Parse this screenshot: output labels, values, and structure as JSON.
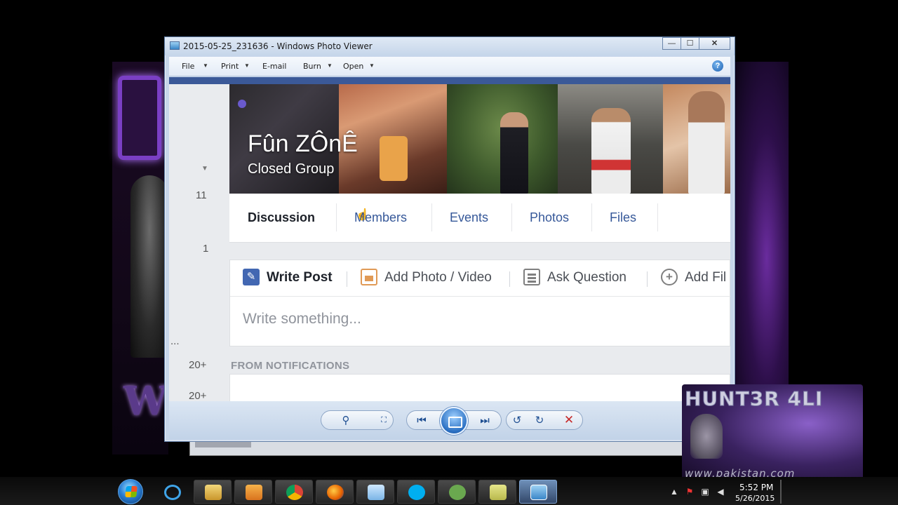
{
  "window": {
    "title": "2015-05-25_231636 - Windows Photo Viewer",
    "controls": {
      "minimize": "—",
      "maximize": "☐",
      "close": "✕"
    }
  },
  "menu": {
    "file": "File",
    "print": "Print",
    "email": "E-mail",
    "burn": "Burn",
    "open": "Open",
    "help_icon": "?"
  },
  "facebook": {
    "left_counts": [
      "11",
      "1",
      "...",
      "20+",
      "20+"
    ],
    "group_name": "Fûn ZÔnÊ",
    "group_type": "Closed Group",
    "tabs": [
      "Discussion",
      "Members",
      "Events",
      "Photos",
      "Files"
    ],
    "active_tab": "Discussion",
    "composer": {
      "write_post": "Write Post",
      "add_photo": "Add Photo / Video",
      "ask_question": "Ask Question",
      "add_file": "Add Fil",
      "placeholder": "Write something..."
    },
    "notifications_heading": "FROM NOTIFICATIONS"
  },
  "viewer_controls": {
    "zoom": "⚲",
    "actual_size": "⛶",
    "previous": "⏮",
    "next": "⏭",
    "rotate_ccw": "↺",
    "rotate_cw": "↻",
    "delete": "✕"
  },
  "wallpaper": {
    "watermark_title": "HUNT3R 4LI",
    "watermark_url": "www.pakistan.com"
  },
  "taskbar": {
    "time": "5:52 PM",
    "date": "5/26/2015",
    "pinned": [
      "windows-explorer",
      "media-player",
      "chrome",
      "firefox",
      "notepad",
      "skype",
      "utorrent",
      "sticky-notes",
      "photo-viewer"
    ]
  },
  "colors": {
    "facebook_blue": "#3b5998",
    "link_blue": "#365899",
    "window_frame": "#c7d6ea"
  }
}
